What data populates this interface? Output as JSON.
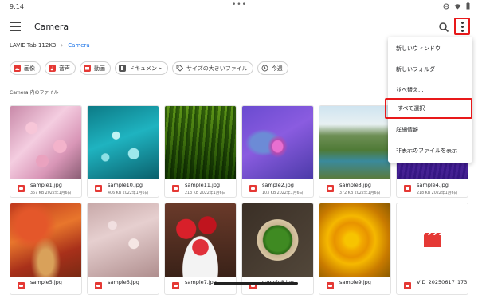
{
  "status": {
    "time": "9:14"
  },
  "appbar": {
    "title": "Camera"
  },
  "breadcrumb": {
    "device": "LAVIE Tab 112K3",
    "current": "Camera"
  },
  "chips": [
    {
      "label": "画像",
      "icon": "image-icon"
    },
    {
      "label": "音声",
      "icon": "audio-icon"
    },
    {
      "label": "動画",
      "icon": "video-icon"
    },
    {
      "label": "ドキュメント",
      "icon": "document-icon"
    },
    {
      "label": "サイズの大きいファイル",
      "icon": "tag-icon"
    },
    {
      "label": "今週",
      "icon": "history-icon"
    }
  ],
  "section_label": "Camera 内のファイル",
  "files": [
    {
      "name": "sample1.jpg",
      "info": "367 KB 2022年1月6日"
    },
    {
      "name": "sample10.jpg",
      "info": "406 KB 2022年1月6日"
    },
    {
      "name": "sample11.jpg",
      "info": "213 KB 2022年1月6日"
    },
    {
      "name": "sample2.jpg",
      "info": "103 KB 2022年1月6日"
    },
    {
      "name": "sample3.jpg",
      "info": "372 KB 2022年1月6日"
    },
    {
      "name": "sample4.jpg",
      "info": "218 KB 2022年1月6日"
    },
    {
      "name": "sample5.jpg",
      "info": ""
    },
    {
      "name": "sample6.jpg",
      "info": ""
    },
    {
      "name": "sample7.jpg",
      "info": ""
    },
    {
      "name": "sample8.jpg",
      "info": ""
    },
    {
      "name": "sample9.jpg",
      "info": ""
    },
    {
      "name": "VID_20250617_173...",
      "info": ""
    }
  ],
  "menu": [
    "新しいウィンドウ",
    "新しいフォルダ",
    "並べ替え...",
    "すべて選択",
    "詳細情報",
    "非表示のファイルを表示"
  ]
}
